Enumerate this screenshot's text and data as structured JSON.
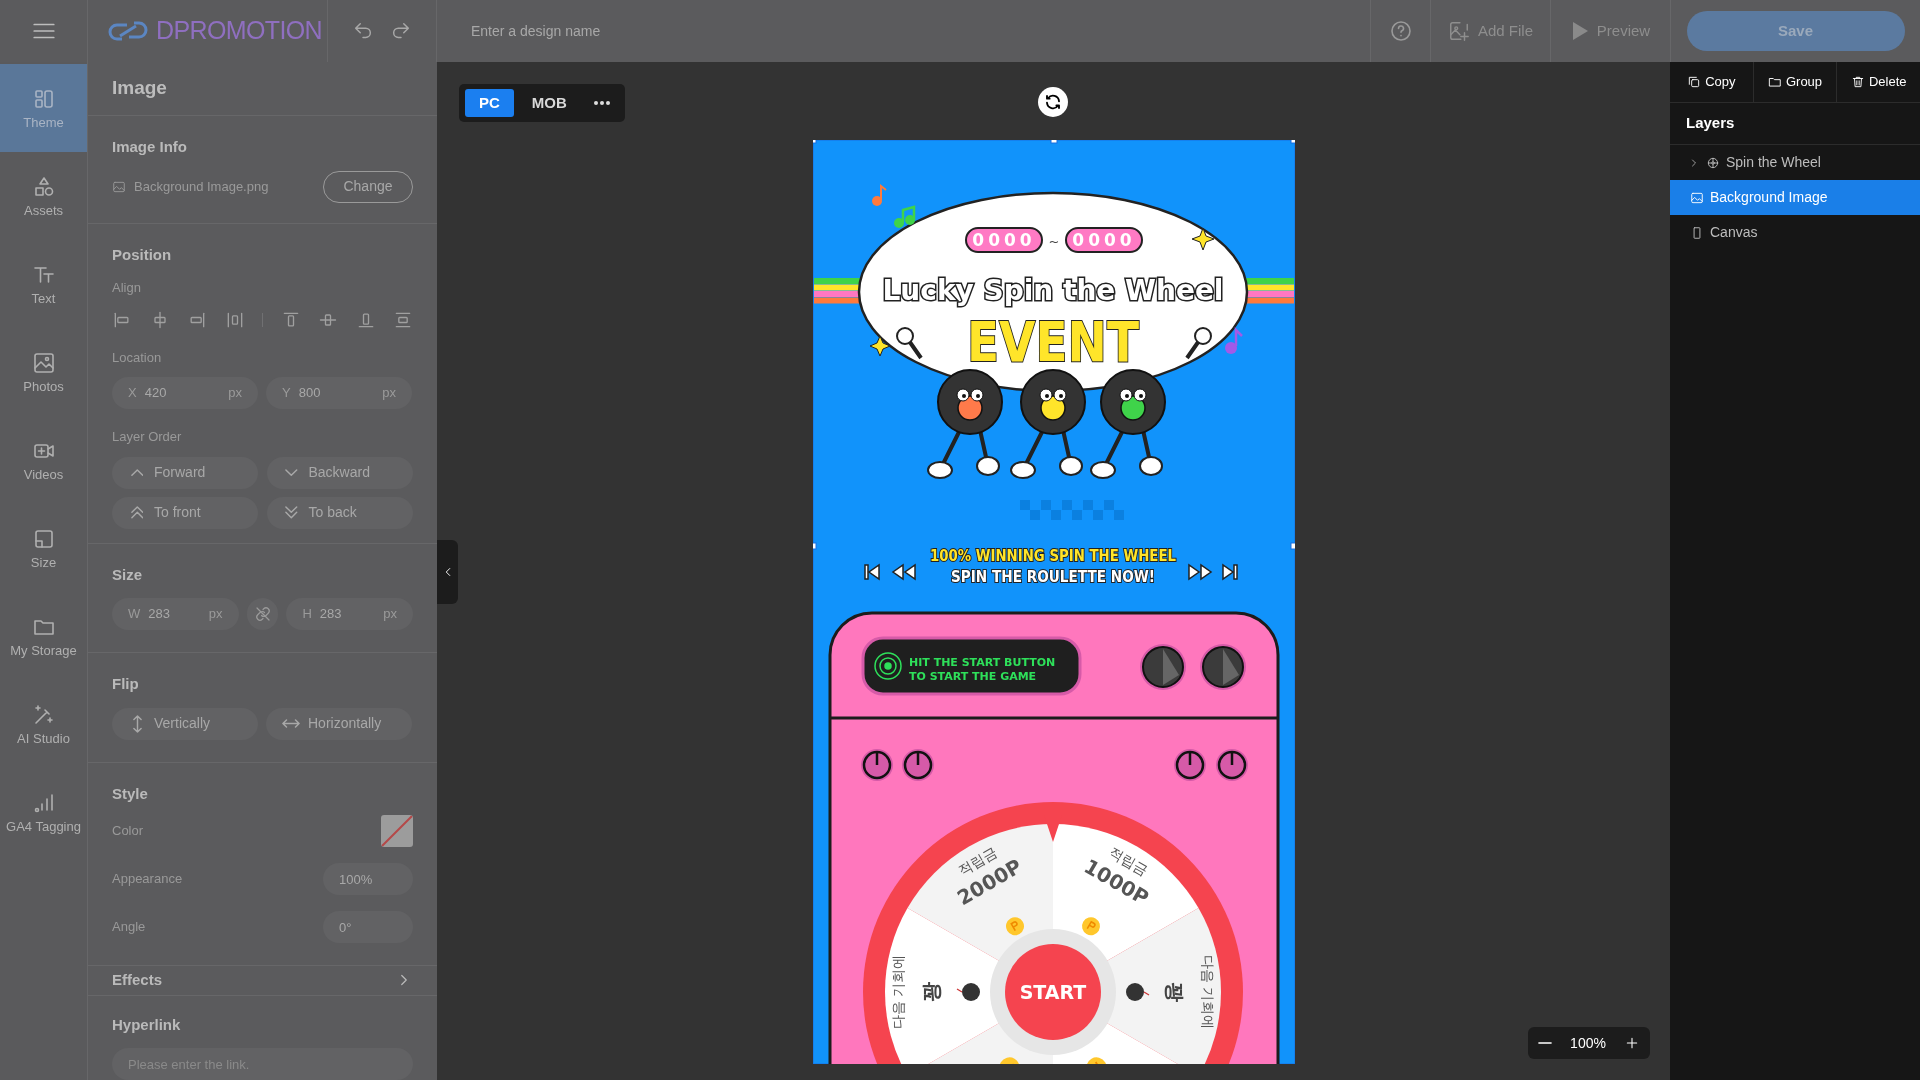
{
  "header": {
    "logo": "DPROMOTION",
    "design_name_placeholder": "Enter a design name",
    "actions": [
      {
        "label": "Add File",
        "kind": "file"
      },
      {
        "label": "Preview",
        "kind": "play"
      }
    ],
    "save": "Save"
  },
  "rail": [
    {
      "label": "Theme",
      "kind": "theme",
      "selected": true
    },
    {
      "label": "Assets",
      "kind": "assets",
      "selected": false
    },
    {
      "label": "Text",
      "kind": "text",
      "selected": false
    },
    {
      "label": "Photos",
      "kind": "photos",
      "selected": false
    },
    {
      "label": "Videos",
      "kind": "videos",
      "selected": false
    },
    {
      "label": "Size",
      "kind": "size",
      "selected": false
    },
    {
      "label": "My Storage",
      "kind": "storage",
      "selected": false
    },
    {
      "label": "AI Studio",
      "kind": "ai",
      "selected": false
    },
    {
      "label": "GA4 Tagging",
      "kind": "ga4",
      "selected": false
    }
  ],
  "panel": {
    "title": "Image",
    "image_info": {
      "title": "Image Info",
      "file": "Background Image.png",
      "change": "Change"
    },
    "position": {
      "title": "Position",
      "align_label": "Align",
      "location_label": "Location",
      "location": [
        {
          "axis": "X",
          "value": "420",
          "unit": "px"
        },
        {
          "axis": "Y",
          "value": "800",
          "unit": "px"
        }
      ],
      "layer_order_label": "Layer Order",
      "layer_order": [
        {
          "label": "Forward",
          "kind": "up"
        },
        {
          "label": "Backward",
          "kind": "down"
        },
        {
          "label": "To front",
          "kind": "top"
        },
        {
          "label": "To back",
          "kind": "bottom"
        }
      ]
    },
    "size": {
      "title": "Size",
      "width": {
        "axis": "W",
        "value": "283",
        "unit": "px"
      },
      "height": {
        "axis": "H",
        "value": "283",
        "unit": "px"
      },
      "linked": false
    },
    "flip": {
      "title": "Flip",
      "buttons": [
        {
          "label": "Vertically",
          "kind": "vertical"
        },
        {
          "label": "Horizontally",
          "kind": "horizontal"
        }
      ]
    },
    "style": {
      "title": "Style",
      "color_label": "Color",
      "appearance_label": "Appearance",
      "appearance": "100%",
      "angle_label": "Angle",
      "angle": "0°"
    },
    "effects": "Effects",
    "hyperlink": {
      "title": "Hyperlink",
      "placeholder": "Please enter the link."
    }
  },
  "canvas": {
    "views": [
      {
        "label": "PC",
        "selected": true
      },
      {
        "label": "MOB",
        "selected": false
      }
    ],
    "zoom": "100%"
  },
  "design": {
    "date_from": "0000",
    "date_sep": "~",
    "date_to": "0000",
    "title": "Lucky Spin the Wheel",
    "subtitle": "EVENT",
    "line1": "100% WINNING SPIN THE WHEEL",
    "line2": "SPIN THE ROULETTE NOW!",
    "display": [
      "HIT THE START BUTTON",
      "TO START THE GAME"
    ],
    "wheel": {
      "start": "START",
      "segments": [
        {
          "top": "적립금",
          "main": "2000P",
          "kind": "prize"
        },
        {
          "top": "적립금",
          "main": "1000P",
          "kind": "prize"
        },
        {
          "top": "다음 기회에",
          "main": "꽝",
          "kind": "miss"
        },
        {
          "kind": "coin"
        },
        {
          "kind": "coin"
        },
        {
          "top": "다음 기회에",
          "main": "꽝",
          "kind": "miss"
        }
      ]
    }
  },
  "layers": {
    "actions": [
      {
        "label": "Copy",
        "kind": "copy"
      },
      {
        "label": "Group",
        "kind": "group"
      },
      {
        "label": "Delete",
        "kind": "delete"
      }
    ],
    "title": "Layers",
    "items": [
      {
        "label": "Spin the Wheel",
        "kind": "wheel",
        "expanded": false,
        "selected": false
      },
      {
        "label": "Background Image",
        "kind": "image",
        "selected": true
      },
      {
        "label": "Canvas",
        "kind": "canvas",
        "selected": false
      }
    ]
  }
}
